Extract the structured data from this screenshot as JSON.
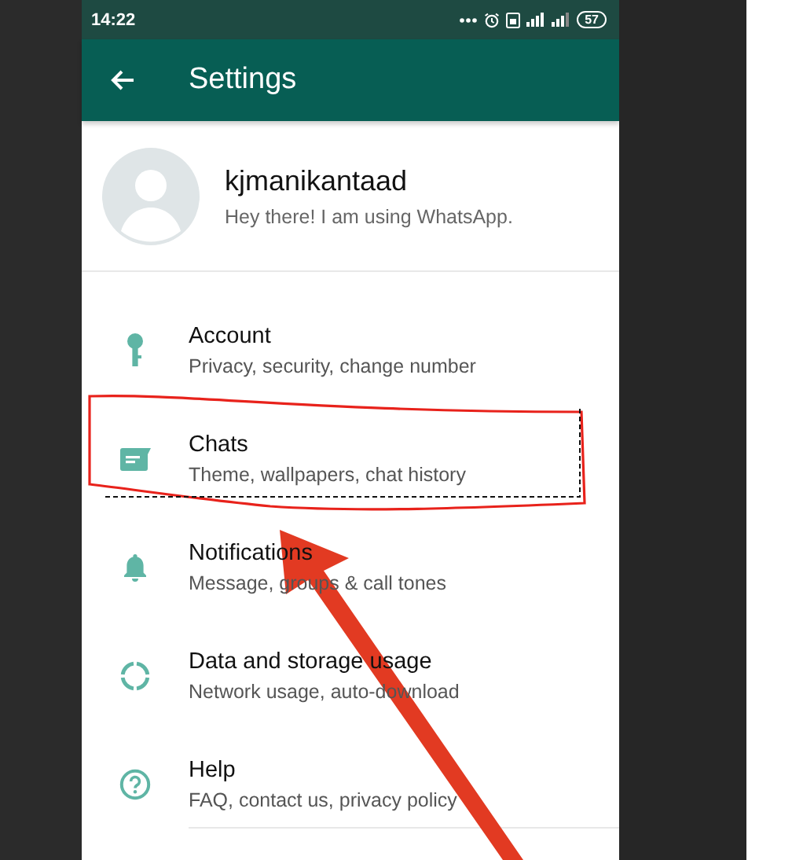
{
  "status_bar": {
    "time": "14:22",
    "battery": "57"
  },
  "toolbar": {
    "title": "Settings"
  },
  "profile": {
    "name": "kjmanikantaad",
    "status": "Hey there! I am using WhatsApp."
  },
  "items": [
    {
      "kind": "key",
      "title": "Account",
      "subtitle": "Privacy, security, change number"
    },
    {
      "kind": "chat",
      "title": "Chats",
      "subtitle": "Theme, wallpapers, chat history"
    },
    {
      "kind": "bell",
      "title": "Notifications",
      "subtitle": "Message, groups & call tones"
    },
    {
      "kind": "data",
      "title": "Data and storage usage",
      "subtitle": "Network usage, auto-download"
    },
    {
      "kind": "help",
      "title": "Help",
      "subtitle": "FAQ, contact us, privacy policy"
    }
  ]
}
